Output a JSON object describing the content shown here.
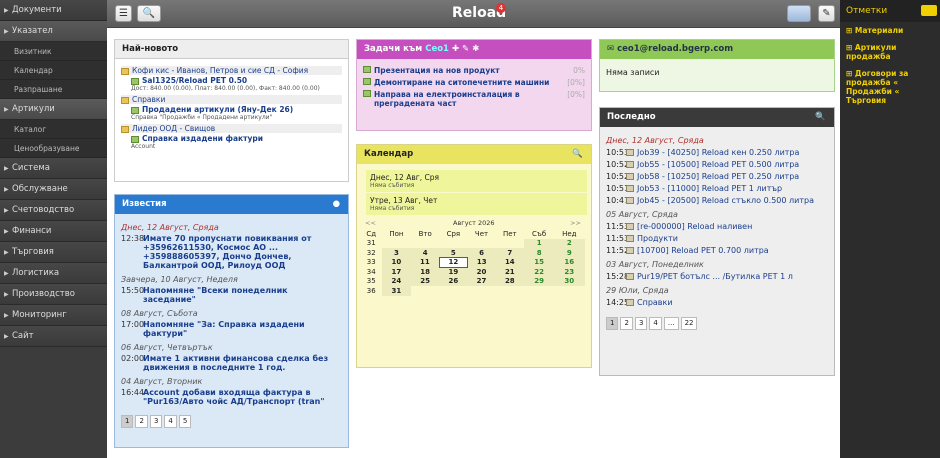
{
  "sidebar": {
    "items": [
      {
        "label": "Документи"
      },
      {
        "label": "Указател",
        "open": true,
        "subs": [
          "Визитник",
          "Календар",
          "Разпрашане"
        ]
      },
      {
        "label": "Артикули",
        "open": true,
        "subs": [
          "Каталог",
          "Ценообразуване"
        ]
      },
      {
        "label": "Система"
      },
      {
        "label": "Обслужване"
      },
      {
        "label": "Счетоводство"
      },
      {
        "label": "Финанси"
      },
      {
        "label": "Търговия"
      },
      {
        "label": "Логистика"
      },
      {
        "label": "Производство"
      },
      {
        "label": "Мониторинг"
      },
      {
        "label": "Сайт"
      }
    ]
  },
  "topbar": {
    "title": "Reload",
    "badge": "4",
    "menu_icon": "☰",
    "search_icon": "🔍"
  },
  "news": {
    "title": "Най-новото",
    "groups": [
      {
        "name": "Кофи кис - Иванов, Петров и сие СД - София",
        "item": "Sal1325/Reload PET 0.50",
        "meta": "Дост: 840.00 (0.00), Плат: 840.00 (0.00), Факт: 840.00 (0.00)"
      },
      {
        "name": "Справки",
        "item": "Продадени артикули (Яну-Дек 26)",
        "meta": "Справка \"Продажби « Продадени артикули\""
      },
      {
        "name": "Лидер ООД - Свищов",
        "item": "Справка издадени фактури",
        "meta": "Account"
      }
    ]
  },
  "notices": {
    "title": "Известия",
    "entries": [
      {
        "date": "Днес, 12 Август, Сряда",
        "time": "12:38",
        "text": "Имате 70 пропуснати повиквания от +35962611530, Космос АО ... +359888605397, Дончо Дончев, Балкантрой ООД, Рилоуд ООД"
      },
      {
        "date": "Завчера, 10 Август, Неделя",
        "time": "15:50",
        "text": "Напомняне \"Всеки понеделник заседание\""
      },
      {
        "date": "08 Август, Събота",
        "time": "17:00",
        "text": "Напомняне \"За: Справка издадени фактури\""
      },
      {
        "date": "06 Август, Четвъртък",
        "time": "02:00",
        "text": "Имате 1 активни финансова сделка без движения в последните 1 год."
      },
      {
        "date": "04 Август, Вторник",
        "time": "16:44",
        "text": "Account добави входяща фактура в \"Pur163/Авто чойс АД/Транспорт (tran\""
      }
    ],
    "pages": [
      "1",
      "2",
      "3",
      "4",
      "5"
    ]
  },
  "tasks": {
    "title": "Задачи към",
    "user": "Ceo1",
    "items": [
      {
        "text": "Презентация на нов продукт",
        "pct": "0%"
      },
      {
        "text": "Демонтиране на ситопечетните машини",
        "pct": "[0%]"
      },
      {
        "text": "Направа на електроинсталация в преградената част",
        "pct": "[0%]"
      }
    ]
  },
  "calendar": {
    "title": "Календар",
    "days": [
      {
        "label": "Днес, 12 Авг, Сря",
        "note": "Няма събития"
      },
      {
        "label": "Утре, 13 Авг, Чет",
        "note": "Няма събития"
      }
    ],
    "month": "Август 2026",
    "prev": "<<",
    "next": ">>",
    "headers": [
      "Сд",
      "Пон",
      "Вто",
      "Сря",
      "Чет",
      "Пет",
      "Съб",
      "Нед"
    ],
    "weeks": [
      [
        "31",
        "",
        "",
        "",
        "",
        "",
        "1",
        "2"
      ],
      [
        "32",
        "3",
        "4",
        "5",
        "6",
        "7",
        "8",
        "9"
      ],
      [
        "33",
        "10",
        "11",
        "12",
        "13",
        "14",
        "15",
        "16"
      ],
      [
        "34",
        "17",
        "18",
        "19",
        "20",
        "21",
        "22",
        "23"
      ],
      [
        "35",
        "24",
        "25",
        "26",
        "27",
        "28",
        "29",
        "30"
      ],
      [
        "36",
        "31",
        "",
        "",
        "",
        "",
        "",
        ""
      ]
    ]
  },
  "inbox": {
    "title": "ceo1@reload.bgerp.com",
    "empty": "Няма записи"
  },
  "recent": {
    "title": "Последно",
    "groups": [
      {
        "date": "Днес, 12 Август, Сряда",
        "rows": [
          {
            "t": "10:53",
            "x": "Job39 - [40250] Reload кен 0.250 литра"
          },
          {
            "t": "10:52",
            "x": "Job55 - [10500] Reload PET 0.500 литра"
          },
          {
            "t": "10:52",
            "x": "Job58 - [10250] Reload PET 0.250 литра"
          },
          {
            "t": "10:51",
            "x": "Job53 - [11000] Reload PET 1 литър"
          },
          {
            "t": "10:47",
            "x": "Job45 - [20500] Reload стъкло 0.500 литра"
          }
        ]
      },
      {
        "date": "05 Август, Сряда",
        "rows": [
          {
            "t": "11:53",
            "x": "[re-000000] Reload наливен"
          },
          {
            "t": "11:53",
            "x": "Продукти"
          },
          {
            "t": "11:52",
            "x": "[10700] Reload PET 0.700 литра"
          }
        ]
      },
      {
        "date": "03 Август, Понеделник",
        "rows": [
          {
            "t": "15:28",
            "x": "Pur19/PET ботълс ... /Бутилка PET 1 л"
          }
        ]
      },
      {
        "date": "29 Юли, Сряда",
        "rows": [
          {
            "t": "14:25",
            "x": "Справки"
          }
        ]
      }
    ],
    "pages": [
      "1",
      "2",
      "3",
      "4",
      "...",
      "22"
    ]
  },
  "right": {
    "title": "Отметки",
    "items": [
      "Материали",
      "Артикули продажба",
      "Договори за продажба « Продажби « Търговия"
    ]
  }
}
